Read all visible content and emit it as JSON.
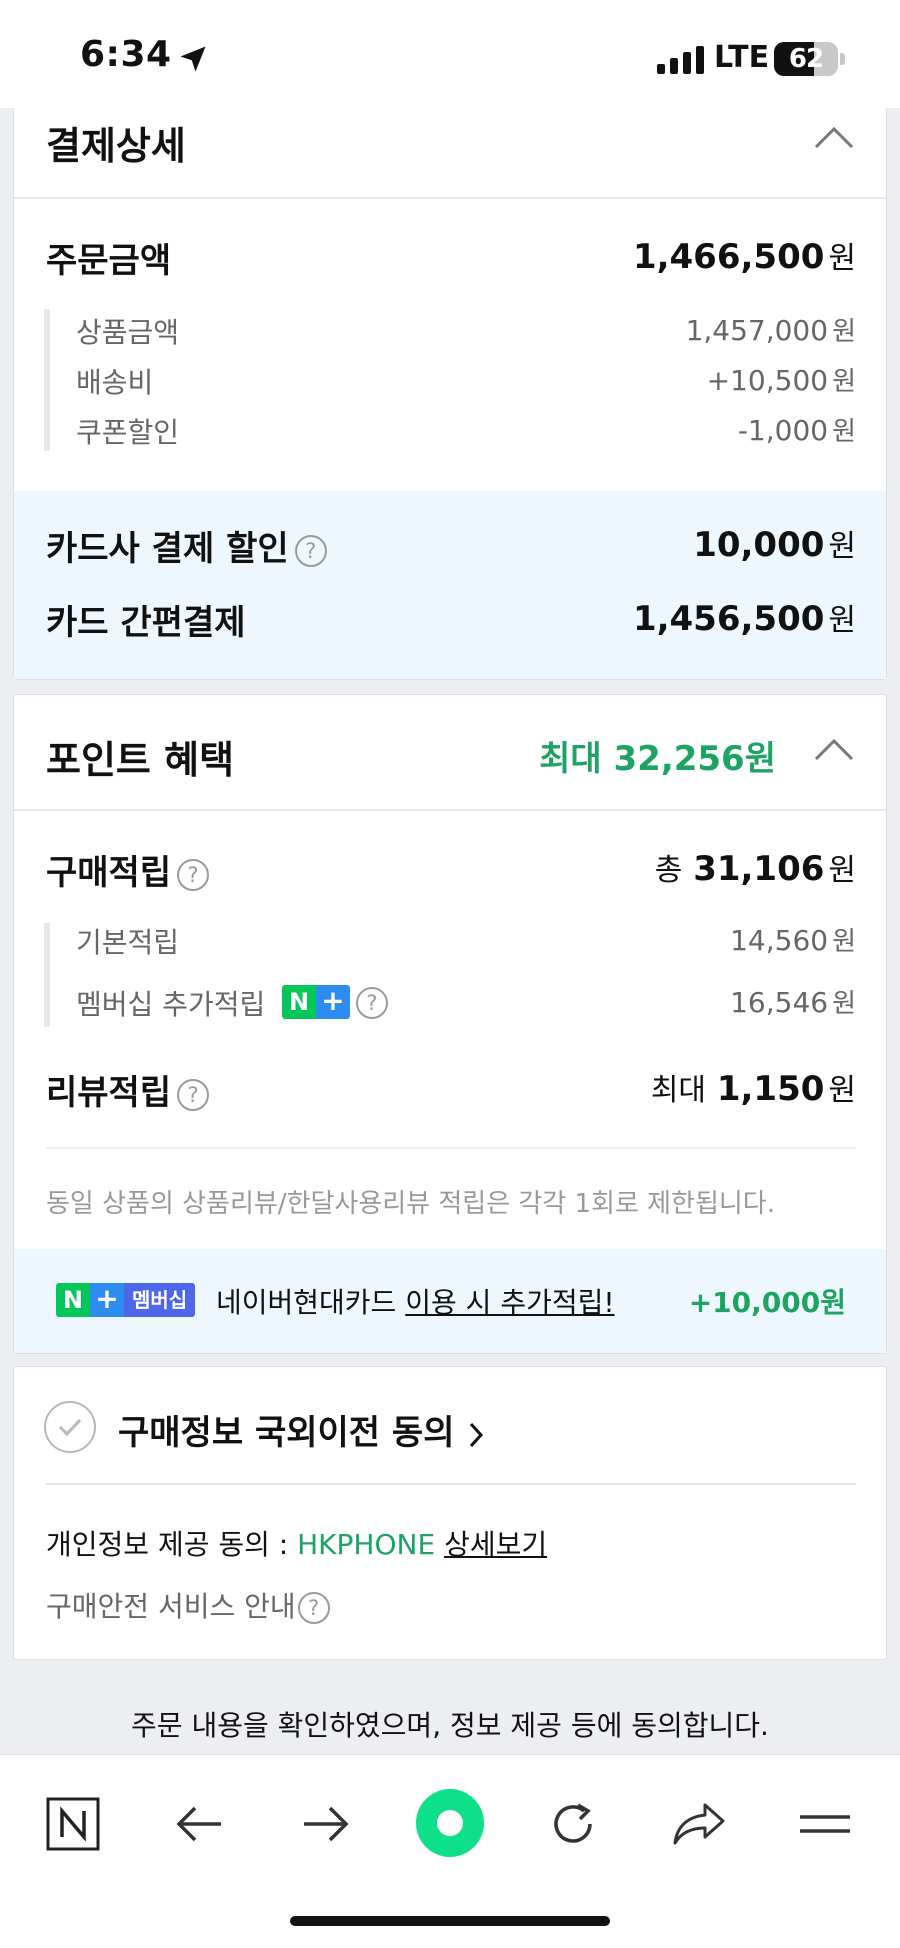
{
  "status": {
    "time": "6:34",
    "network": "LTE",
    "battery": "62",
    "battery_level": 0.62
  },
  "payment": {
    "title": "결제상세",
    "order_amount": {
      "label": "주문금액",
      "value": "1,466,500",
      "unit": "원"
    },
    "items": [
      {
        "label": "상품금액",
        "value": "1,457,000",
        "unit": "원"
      },
      {
        "label": "배송비",
        "value": "+10,500",
        "unit": "원"
      },
      {
        "label": "쿠폰할인",
        "value": "-1,000",
        "unit": "원"
      }
    ],
    "card_discount": {
      "label": "카드사 결제 할인",
      "value": "10,000",
      "unit": "원"
    },
    "card_pay": {
      "label": "카드 간편결제",
      "value": "1,456,500",
      "unit": "원"
    }
  },
  "points": {
    "title": "포인트 혜택",
    "max": "최대 32,256원",
    "purchase": {
      "label": "구매적립",
      "prefix": "총",
      "value": "31,106",
      "unit": "원"
    },
    "items": [
      {
        "label": "기본적립",
        "value": "14,560",
        "unit": "원"
      },
      {
        "label": "멤버십 추가적립",
        "value": "16,546",
        "unit": "원"
      }
    ],
    "review": {
      "label": "리뷰적립",
      "prefix": "최대",
      "value": "1,150",
      "unit": "원"
    },
    "notice": "동일 상품의 상품리뷰/한달사용리뷰 적립은 각각 1회로 제한됩니다.",
    "promo": {
      "badge_n": "N",
      "badge_plus": "+",
      "badge_member": "멤버십",
      "text": "네이버현대카드",
      "link": "이용 시 추가적립!",
      "amount": "+10,000원"
    }
  },
  "consent": {
    "title": "구매정보 국외이전 동의",
    "privacy_label": "개인정보 제공 동의 :",
    "seller": "HKPHONE",
    "detail_link": "상세보기",
    "safety": "구매안전 서비스 안내"
  },
  "confirm_text": "주문 내용을 확인하였으며, 정보 제공 등에 동의합니다.",
  "colors": {
    "accent": "#1da462",
    "naver_green": "#03c75a",
    "band": "#eef7fd"
  },
  "toolbar": [
    "naver-home-icon",
    "back-arrow-icon",
    "forward-arrow-icon",
    "green-dot-icon",
    "refresh-icon",
    "share-icon",
    "menu-icon"
  ]
}
